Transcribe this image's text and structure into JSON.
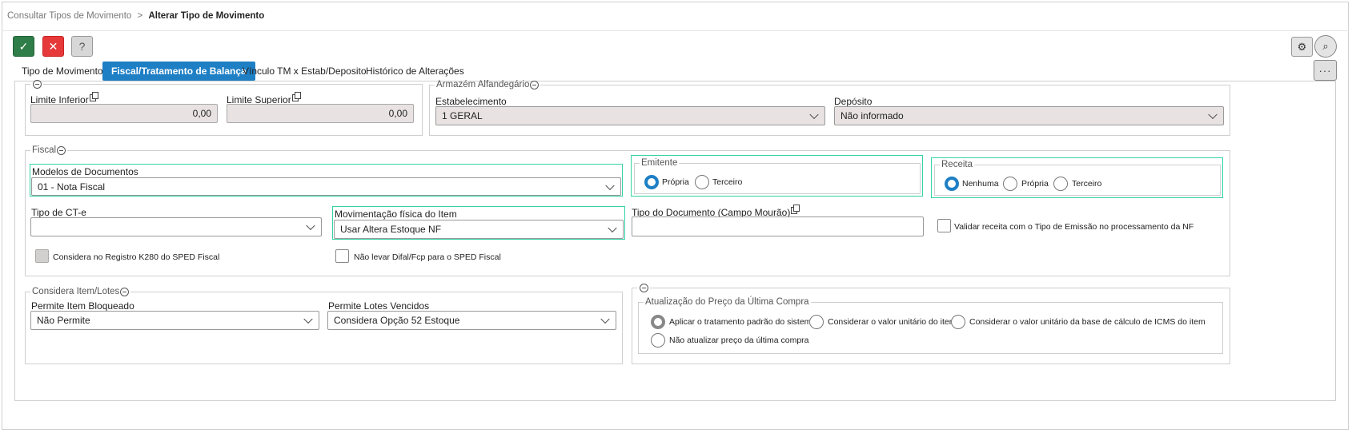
{
  "breadcrumb": {
    "parent": "Consultar Tipos de Movimento",
    "sep": ">",
    "current": "Alterar Tipo de Movimento"
  },
  "toolbar": {
    "confirm": "✓",
    "cancel": "✕",
    "help": "?",
    "settings": "⚙",
    "search": "⌕",
    "more": "···"
  },
  "tabs": [
    "Tipo de Movimento",
    "Fiscal/Tratamento de Balança",
    "Vínculo TM x Estab/Deposito",
    "Histórico de Alterações"
  ],
  "limits": {
    "inferior_label": "Limite Inferior",
    "inferior_value": "0,00",
    "superior_label": "Limite Superior",
    "superior_value": "0,00"
  },
  "armazem": {
    "legend": "Armazém Alfandegário",
    "estab_label": "Estabelecimento",
    "estab_value": "1 GERAL",
    "deposito_label": "Depósito",
    "deposito_value": "Não informado"
  },
  "fiscal": {
    "legend": "Fiscal",
    "modelos_label": "Modelos de Documentos",
    "modelos_value": "01 - Nota Fiscal",
    "emitente_legend": "Emitente",
    "emitente_opts": [
      "Própria",
      "Terceiro"
    ],
    "receita_legend": "Receita",
    "receita_opts": [
      "Nenhuma",
      "Própria",
      "Terceiro"
    ],
    "cte_label": "Tipo de CT-e",
    "cte_value": "",
    "mov_label": "Movimentação física do Item",
    "mov_value": "Usar Altera Estoque NF",
    "tipodoc_label": "Tipo do Documento (Campo Mourão)",
    "tipodoc_value": "",
    "validar_label": "Validar receita com o Tipo de Emissão no processamento da NF",
    "k280_label": "Considera no Registro K280 do SPED Fiscal",
    "difal_label": "Não levar Difal/Fcp para o SPED Fiscal"
  },
  "item_lotes": {
    "legend": "Considera Item/Lotes",
    "bloq_label": "Permite Item Bloqueado",
    "bloq_value": "Não Permite",
    "venc_label": "Permite Lotes Vencidos",
    "venc_value": "Considera Opção 52 Estoque"
  },
  "preco": {
    "legend": "Atualização do Preço da Última Compra",
    "opts": [
      "Aplicar o tratamento padrão do sistema",
      "Considerar o valor unitário do item",
      "Considerar o valor unitário da base de cálculo de ICMS do item",
      "Não atualizar preço da última compra"
    ]
  }
}
